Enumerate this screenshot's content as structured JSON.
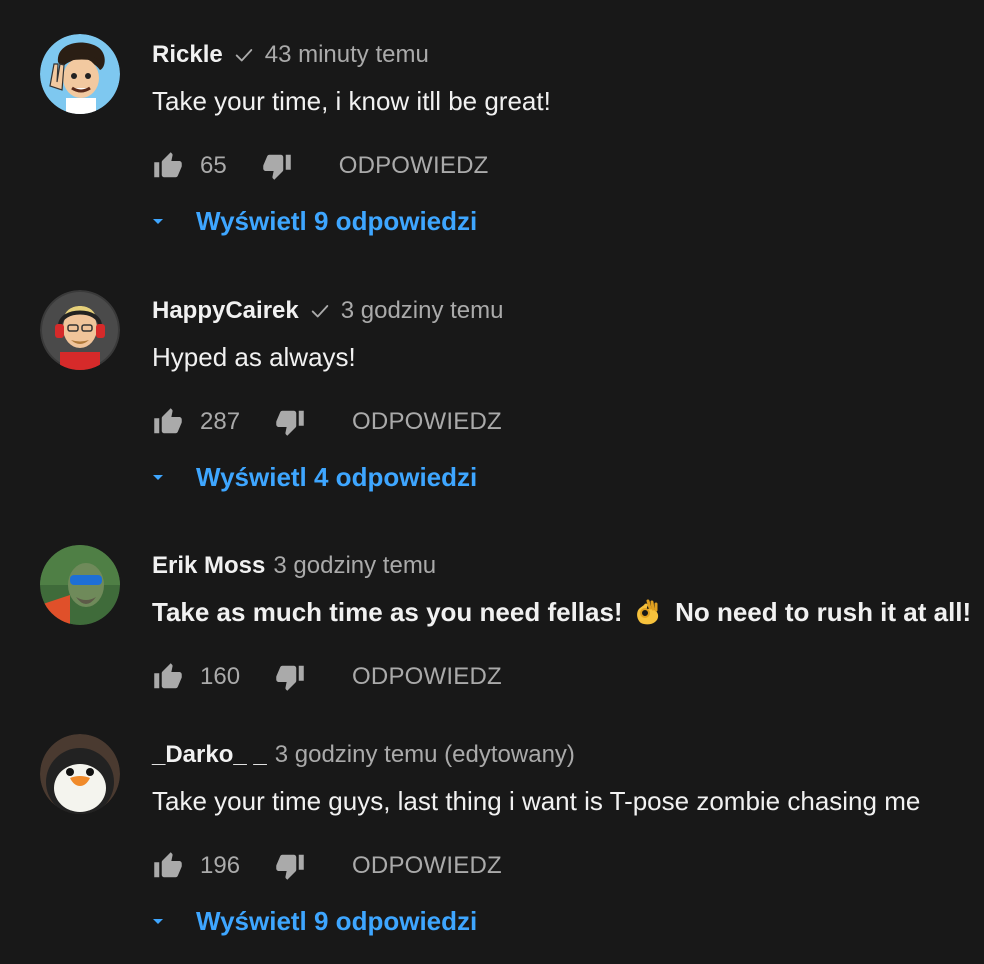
{
  "comments": [
    {
      "author": "Rickle",
      "verified": true,
      "time": "43 minuty temu",
      "text": "Take your time, i know itll be great!",
      "likes": "65",
      "reply_label": "ODPOWIEDZ",
      "view_replies": "Wyświetl 9 odpowiedzi"
    },
    {
      "author": "HappyCairek",
      "verified": true,
      "time": "3 godziny temu",
      "text": "Hyped as always!",
      "likes": "287",
      "reply_label": "ODPOWIEDZ",
      "view_replies": "Wyświetl 4 odpowiedzi"
    },
    {
      "author": "Erik Moss",
      "verified": false,
      "time": "3 godziny temu",
      "text_before_emoji": "Take as much time as you need fellas!",
      "emoji": "ok-hand-emoji",
      "text_after_emoji": "No need to rush it at all!",
      "likes": "160",
      "reply_label": "ODPOWIEDZ"
    },
    {
      "author": "_Darko_ _",
      "verified": false,
      "time": "3 godziny temu (edytowany)",
      "text": "Take your time guys, last thing i want is T-pose zombie chasing me",
      "likes": "196",
      "reply_label": "ODPOWIEDZ",
      "view_replies": "Wyświetl 9 odpowiedzi"
    }
  ],
  "icons": {
    "like": "thumbs-up-icon",
    "dislike": "thumbs-down-icon",
    "verified": "checkmark-icon",
    "expand": "caret-down-icon"
  },
  "colors": {
    "background": "#181818",
    "primary_text": "#f1f1f1",
    "secondary_text": "#aaaaaa",
    "link_blue": "#3ea6ff"
  }
}
